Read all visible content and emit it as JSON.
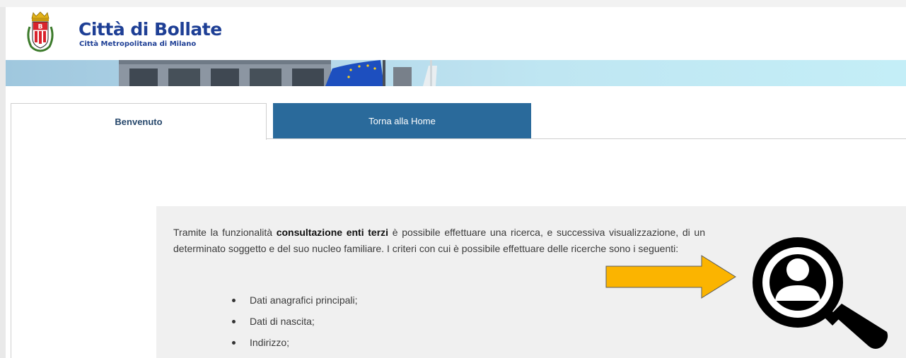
{
  "header": {
    "title": "Città di Bollate",
    "subtitle": "Città Metropolitana di Milano",
    "crest_letter": "B"
  },
  "tabs": [
    {
      "label": "Benvenuto",
      "active": true
    },
    {
      "label": "Torna alla Home",
      "active": false
    }
  ],
  "intro": {
    "before": "Tramite la funzionalità ",
    "bold": "consultazione enti terzi",
    "after": " è possibile effettuare una ricerca, e successiva visualizzazione, di un determinato soggetto e del suo nucleo familiare. I criteri con cui è possibile effettuare delle ricerche sono i seguenti:"
  },
  "criteria": [
    "Dati anagrafici principali;",
    "Dati di nascita;",
    "Indirizzo;"
  ],
  "icons": {
    "arrow": "arrow-right-icon",
    "search": "person-search-icon"
  },
  "colors": {
    "brand": "#1e3f95",
    "tab_active_text": "#26476b",
    "tab_inactive_bg": "#2a6a9b",
    "arrow": "#fbb400"
  }
}
